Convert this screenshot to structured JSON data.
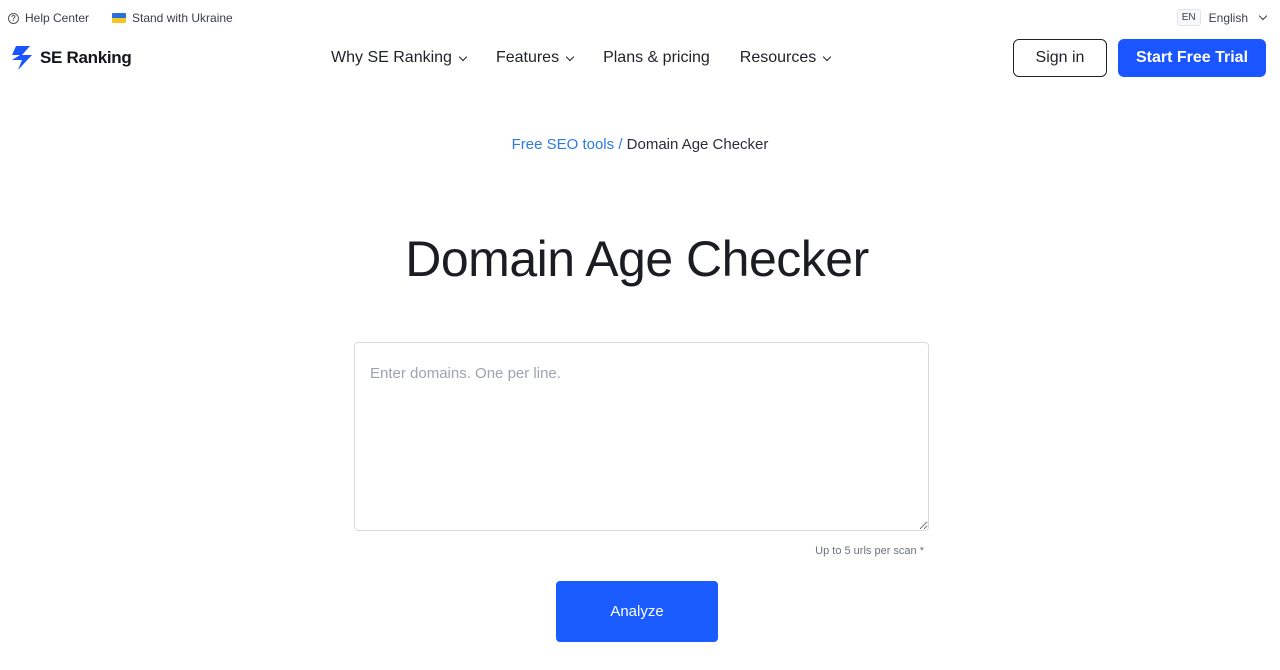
{
  "topbar": {
    "help_center": "Help Center",
    "stand_with_ukraine": "Stand with Ukraine",
    "lang_code": "EN",
    "lang_name": "English"
  },
  "nav": {
    "logo_text": "SE Ranking",
    "menu": [
      {
        "label": "Why SE Ranking",
        "has_dropdown": true
      },
      {
        "label": "Features",
        "has_dropdown": true
      },
      {
        "label": "Plans & pricing",
        "has_dropdown": false
      },
      {
        "label": "Resources",
        "has_dropdown": true
      }
    ],
    "sign_in": "Sign in",
    "start_trial": "Start Free Trial"
  },
  "breadcrumb": {
    "parent": "Free SEO tools",
    "separator": "/",
    "current": "Domain Age Checker"
  },
  "main": {
    "title": "Domain Age Checker",
    "input_placeholder": "Enter domains. One per line.",
    "input_value": "",
    "hint": "Up to 5 urls per scan *",
    "analyze_label": "Analyze"
  },
  "colors": {
    "accent": "#1a55ff",
    "link": "#2b7be4",
    "ukraine_blue": "#2a6fdb",
    "ukraine_yellow": "#f3c623"
  },
  "icons": [
    "help-icon",
    "ukraine-flag-icon",
    "chevron-down-icon",
    "se-ranking-logo-icon",
    "resize-handle-icon"
  ]
}
